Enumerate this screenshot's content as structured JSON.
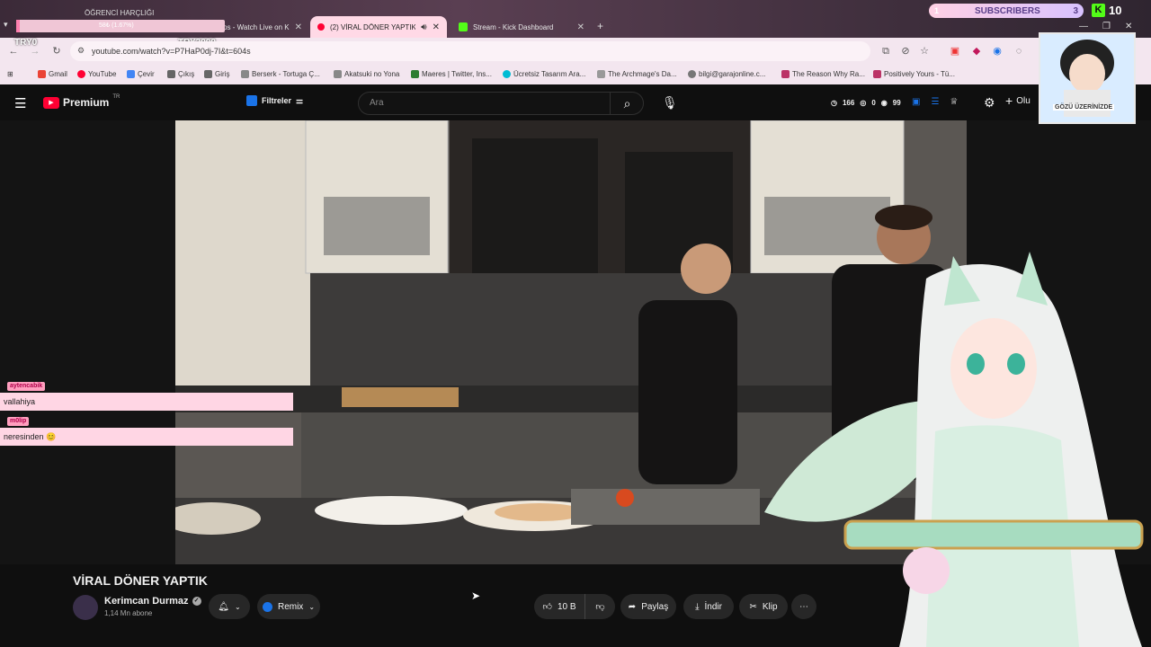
{
  "overlay": {
    "donation_label": "ÖĞRENCİ HARÇLIĞI",
    "donation_progress_text": "58₺ (1.67%)",
    "donation_progress": 0.0167,
    "goal_current": "TRY0",
    "goal_target": "TRY3000",
    "subs_left": "1",
    "subs_label": "SUBSCRIBERS",
    "subs_right": "3",
    "kick_count": "10",
    "avatar_caption": "GÖZÜ ÜZERİNİZDE"
  },
  "browser": {
    "tabs": [
      {
        "label": "ps - Watch Live on K",
        "active": false
      },
      {
        "label": "(2) VİRAL DÖNER YAPTIK -",
        "active": true
      },
      {
        "label": "Stream - Kick Dashboard",
        "active": false
      }
    ],
    "url": "youtube.com/watch?v=P7HaP0dj-7I&t=604s",
    "bookmarks": [
      "Gmail",
      "YouTube",
      "Çevir",
      "Çıkış",
      "Giriş",
      "Berserk - Tortuga Ç...",
      "Akatsuki no Yona",
      "Maeres | Twitter, Ins...",
      "Ücretsiz Tasarım Ara...",
      "The Archmage's Da...",
      "bilgi@garajonline.c...",
      "The Reason Why Ra...",
      "Positively Yours - Tü..."
    ]
  },
  "youtube": {
    "logo_text": "Premium",
    "logo_region": "TR",
    "filters_label": "Filtreler",
    "search_placeholder": "Ara",
    "stat_views": "166",
    "stat_a": "0",
    "stat_b": "99",
    "create_label": "Olu"
  },
  "chat": [
    {
      "name": "aytencabik",
      "message": "vallahiya"
    },
    {
      "name": "m0lip",
      "message": "neresinden 😊"
    }
  ],
  "video": {
    "title": "VİRAL DÖNER YAPTIK",
    "channel": "Kerimcan Durmaz",
    "subscribers": "1,14 Mn abone",
    "remix_label": "Remix",
    "likes": "10 B",
    "share_label": "Paylaş",
    "download_label": "İndir",
    "clip_label": "Klip"
  },
  "colors": {
    "youtube_red": "#ff0033",
    "chat_bg": "#ffd6e4",
    "active_tab": "#ffd9e6",
    "kick_green": "#53fc18"
  }
}
